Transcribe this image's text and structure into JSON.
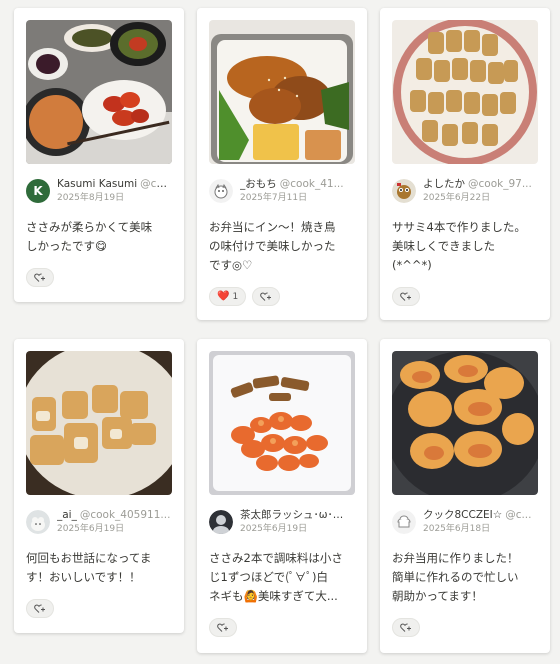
{
  "cards": [
    {
      "author": "Kasumi Kasumi",
      "handle": "@cookpad_user",
      "date": "2025年8月19日",
      "avatar_letter": "K",
      "comment_lines": [
        "ささみが柔らかくて美味",
        "しかったです😋"
      ],
      "reactions": []
    },
    {
      "author": "_おもち",
      "handle": "@cook_41...",
      "date": "2025年7月11日",
      "comment_lines": [
        "お弁当にイン〜！焼き鳥",
        "の味付けで美味しかった",
        "です◎♡"
      ],
      "reactions": [
        {
          "emoji": "❤️",
          "count": "1"
        }
      ]
    },
    {
      "author": "よしたか",
      "handle": "@cook_97...",
      "date": "2025年6月22日",
      "comment_lines": [
        "ササミ4本で作りました。",
        "美味しくできました",
        "(*^^*)"
      ],
      "reactions": []
    },
    {
      "author": "_ai_",
      "handle": "@cook_405911...",
      "date": "2025年6月19日",
      "comment_lines": [
        "何回もお世話になってま",
        "す！おいしいです！！"
      ],
      "reactions": []
    },
    {
      "author": "茶太郎ラッシュ･ω･",
      "handle": "@cook",
      "date": "2025年6月19日",
      "comment_lines": [
        "ささみ2本で調味料は小さ",
        "じ1ずつほどで(ﾟ∀ﾟ)白",
        "ネギも🙆美味すぎて大..."
      ],
      "reactions": []
    },
    {
      "author": "クック8CCZEI☆",
      "handle": "@c...",
      "date": "2025年6月18日",
      "comment_lines": [
        "お弁当用に作りました！",
        "簡単に作れるので忙しい",
        "朝助かってます！"
      ],
      "reactions": []
    }
  ]
}
